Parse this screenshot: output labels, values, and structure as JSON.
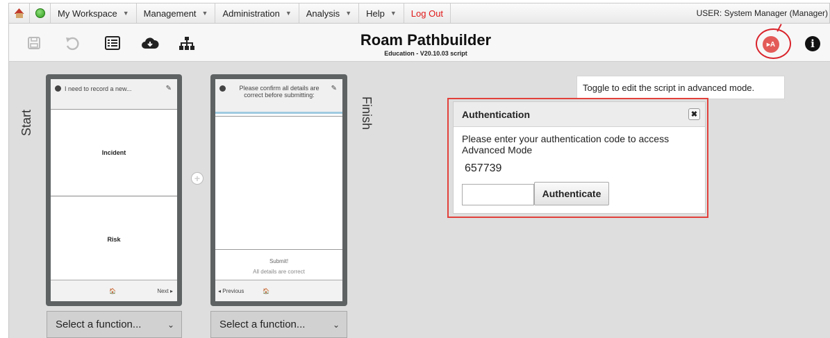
{
  "menu": {
    "items": [
      {
        "label": "My Workspace"
      },
      {
        "label": "Management"
      },
      {
        "label": "Administration"
      },
      {
        "label": "Analysis"
      },
      {
        "label": "Help"
      }
    ],
    "logout": "Log Out",
    "user": "USER: System Manager (Manager)"
  },
  "header": {
    "title": "Roam Pathbuilder",
    "subtitle": "Education - V20.10.03 script",
    "advanced_badge": "▸A",
    "info_glyph": "i"
  },
  "canvas": {
    "start_label": "Start",
    "finish_label": "Finish",
    "phone1": {
      "header_text": "I need to record a new...",
      "options": [
        "Incident",
        "Risk"
      ],
      "footer_next": "Next ▸",
      "home_glyph": "🏠"
    },
    "phone2": {
      "header_text": "Please confirm all details are correct before submitting:",
      "submit_title": "Submit!",
      "submit_sub": "All details are correct",
      "footer_prev": "◂ Previous",
      "home_glyph": "🏠"
    },
    "select1": "Select a function...",
    "select2": "Select a function..."
  },
  "tooltip": "Toggle to edit the script in advanced mode.",
  "dialog": {
    "title": "Authentication",
    "close_glyph": "✖",
    "message": "Please enter your authentication code to access Advanced Mode",
    "code": "657739",
    "input_value": "",
    "button": "Authenticate"
  },
  "colors": {
    "accent_red": "#e2403a",
    "canvas_bg": "#dedede"
  }
}
